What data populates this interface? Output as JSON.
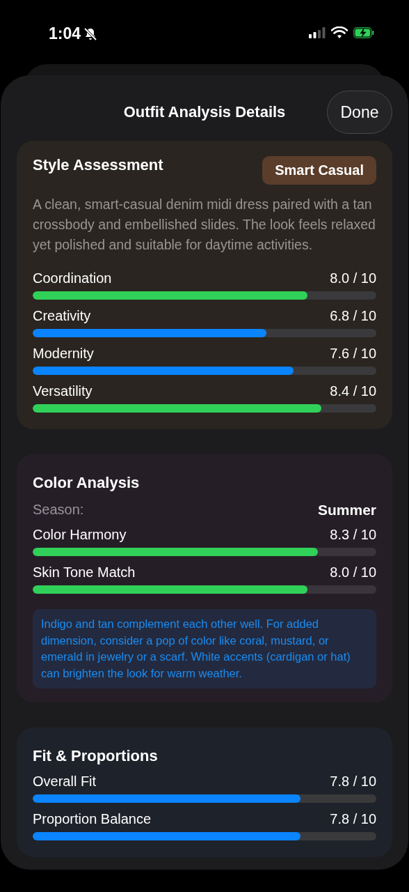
{
  "status_bar": {
    "time": "1:04"
  },
  "header": {
    "title": "Outfit Analysis Details",
    "done_button": "Done"
  },
  "style_assessment": {
    "title": "Style Assessment",
    "badge": "Smart Casual",
    "description": "A clean, smart-casual denim midi dress paired with a tan crossbody and embellished slides. The look feels relaxed yet polished and suitable for daytime activities.",
    "metrics": [
      {
        "name": "Coordination",
        "reading": "8.0 / 10",
        "level": 0.8,
        "color": "#30d158"
      },
      {
        "name": "Creativity",
        "reading": "6.8 / 10",
        "level": 0.68,
        "color": "#0a84ff"
      },
      {
        "name": "Modernity",
        "reading": "7.6 / 10",
        "level": 0.76,
        "color": "#0a84ff"
      },
      {
        "name": "Versatility",
        "reading": "8.4 / 10",
        "level": 0.84,
        "color": "#30d158"
      }
    ]
  },
  "color_analysis": {
    "title": "Color Analysis",
    "season_label": "Season:",
    "season": "Summer",
    "metrics": [
      {
        "name": "Color Harmony",
        "reading": "8.3 / 10",
        "level": 0.83,
        "color": "#30d158"
      },
      {
        "name": "Skin Tone Match",
        "reading": "8.0 / 10",
        "level": 0.8,
        "color": "#30d158"
      }
    ],
    "note": "Indigo and tan complement each other well. For added dimension, consider a pop of color like coral, mustard, or emerald in jewelry or a scarf. White accents (cardigan or hat) can brighten the look for warm weather."
  },
  "fit_proportions": {
    "title": "Fit & Proportions",
    "metrics": [
      {
        "name": "Overall Fit",
        "reading": "7.8 / 10",
        "level": 0.78,
        "color": "#0a84ff"
      },
      {
        "name": "Proportion Balance",
        "reading": "7.8 / 10",
        "level": 0.78,
        "color": "#0a84ff"
      }
    ]
  }
}
